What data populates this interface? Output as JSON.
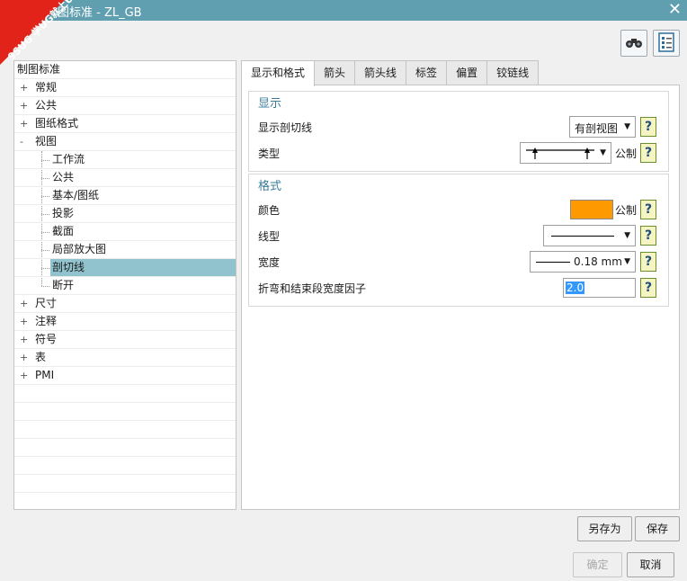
{
  "window": {
    "title": "图标准 - ZL_GB",
    "close_glyph": "✕",
    "watermark": "9SUG 学UG就上UG网"
  },
  "toolbar": {
    "icons": [
      "binoculars-icon",
      "settings-sheet-icon"
    ]
  },
  "tree": {
    "root": "制图标准",
    "items": [
      {
        "label": "常规",
        "level": 1,
        "expander": "+"
      },
      {
        "label": "公共",
        "level": 1,
        "expander": "+"
      },
      {
        "label": "图纸格式",
        "level": 1,
        "expander": "+"
      },
      {
        "label": "视图",
        "level": 1,
        "expander": "-"
      },
      {
        "label": "工作流",
        "level": 2
      },
      {
        "label": "公共",
        "level": 2
      },
      {
        "label": "基本/图纸",
        "level": 2
      },
      {
        "label": "投影",
        "level": 2
      },
      {
        "label": "截面",
        "level": 2
      },
      {
        "label": "局部放大图",
        "level": 2
      },
      {
        "label": "剖切线",
        "level": 2,
        "selected": true
      },
      {
        "label": "断开",
        "level": 2
      },
      {
        "label": "尺寸",
        "level": 1,
        "expander": "+"
      },
      {
        "label": "注释",
        "level": 1,
        "expander": "+"
      },
      {
        "label": "符号",
        "level": 1,
        "expander": "+"
      },
      {
        "label": "表",
        "level": 1,
        "expander": "+"
      },
      {
        "label": "PMI",
        "level": 1,
        "expander": "+"
      }
    ]
  },
  "tabs": [
    "显示和格式",
    "箭头",
    "箭头线",
    "标签",
    "偏置",
    "铰链线"
  ],
  "display_group": {
    "title": "显示",
    "show_label": "显示剖切线",
    "show_value": "有剖视图",
    "type_label": "类型",
    "type_unit": "公制"
  },
  "format_group": {
    "title": "格式",
    "color_label": "颜色",
    "color_value": "#ff9900",
    "color_unit": "公制",
    "linetype_label": "线型",
    "width_label": "宽度",
    "width_value": "0.18 mm",
    "factor_label": "折弯和结束段宽度因子",
    "factor_value": "2.0"
  },
  "help_glyph": "?",
  "buttons": {
    "save_as": "另存为",
    "save": "保存",
    "ok": "确定",
    "cancel": "取消"
  }
}
